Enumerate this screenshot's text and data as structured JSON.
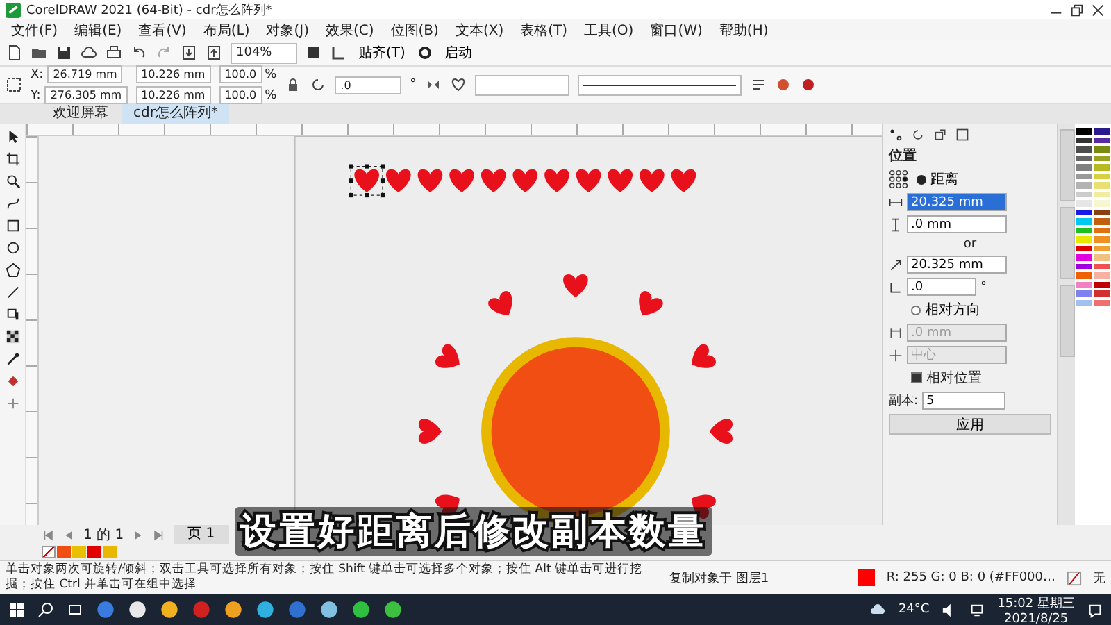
{
  "window": {
    "title": "CorelDRAW 2021 (64-Bit) - cdr怎么阵列*"
  },
  "menu": [
    "文件(F)",
    "编辑(E)",
    "查看(V)",
    "布局(L)",
    "对象(J)",
    "效果(C)",
    "位图(B)",
    "文本(X)",
    "表格(T)",
    "工具(O)",
    "窗口(W)",
    "帮助(H)"
  ],
  "toolbar": {
    "zoom": "104%",
    "snap": "贴齐(T)",
    "launch": "启动"
  },
  "property_bar": {
    "x_label": "X:",
    "x": "26.719 mm",
    "y_label": "Y:",
    "y": "276.305 mm",
    "width": "10.226 mm",
    "height": "10.226 mm",
    "scales": [
      {
        "value": "100.0",
        "unit": "%"
      },
      {
        "value": "100.0",
        "unit": "%"
      }
    ],
    "rotation": ".0",
    "rotation_unit": "°"
  },
  "doc_tabs": [
    {
      "label": "欢迎屏幕",
      "selected": false
    },
    {
      "label": "cdr怎么阵列*",
      "selected": true
    }
  ],
  "heart_row": [
    {
      "selected": true
    },
    {
      "selected": false
    },
    {
      "selected": false
    },
    {
      "selected": false
    },
    {
      "selected": false
    },
    {
      "selected": false
    },
    {
      "selected": false
    },
    {
      "selected": false
    },
    {
      "selected": false
    },
    {
      "selected": false
    },
    {
      "selected": false
    }
  ],
  "caption": "设置好距离后修改副本数量",
  "docker": {
    "title": "位置",
    "modes": [
      {
        "label": "距离",
        "selected": true
      },
      {
        "label": "相对方向",
        "selected": false
      }
    ],
    "distance_fields": [
      {
        "value": "20.325 mm",
        "highlighted": true
      },
      {
        "value": ".0 mm",
        "highlighted": false
      }
    ],
    "or_label": "or",
    "vector_fields": [
      {
        "value": "20.325 mm"
      },
      {
        "value": ".0",
        "unit": "°"
      }
    ],
    "relative_fields": [
      {
        "value": ".0 mm",
        "disabled": true
      },
      {
        "value": "中心",
        "disabled": true
      }
    ],
    "relative_position": {
      "label": "相对位置",
      "checked": true
    },
    "copies_label": "副本:",
    "copies": "5",
    "apply": "应用"
  },
  "palette": [
    {
      "color": "#000000"
    },
    {
      "color": "#2a1a8a"
    },
    {
      "color": "#333333"
    },
    {
      "color": "#5a2aa0"
    },
    {
      "color": "#4d4d4d"
    },
    {
      "color": "#7a8a10"
    },
    {
      "color": "#666666"
    },
    {
      "color": "#9aa020"
    },
    {
      "color": "#808080"
    },
    {
      "color": "#b8b820"
    },
    {
      "color": "#999999"
    },
    {
      "color": "#d8d040"
    },
    {
      "color": "#b3b3b3"
    },
    {
      "color": "#e8e070"
    },
    {
      "color": "#cccccc"
    },
    {
      "color": "#f0eca0"
    },
    {
      "color": "#e6e6e6"
    },
    {
      "color": "#f8f6d0"
    },
    {
      "color": "#1a1ae6"
    },
    {
      "color": "#8a4010"
    },
    {
      "color": "#00c8f0"
    },
    {
      "color": "#c06010"
    },
    {
      "color": "#20c020"
    },
    {
      "color": "#e07010"
    },
    {
      "color": "#e8e800"
    },
    {
      "color": "#f09020"
    },
    {
      "color": "#e00000"
    },
    {
      "color": "#f0a030"
    },
    {
      "color": "#e000e0"
    },
    {
      "color": "#f0c080"
    },
    {
      "color": "#a000e0"
    },
    {
      "color": "#f05050"
    },
    {
      "color": "#f06000"
    },
    {
      "color": "#f8b0a0"
    },
    {
      "color": "#f080c0"
    },
    {
      "color": "#c00000"
    },
    {
      "color": "#8080f0"
    },
    {
      "color": "#d03030"
    },
    {
      "color": "#a0c0f0"
    },
    {
      "color": "#f07070"
    }
  ],
  "page_nav": {
    "count": "1 的 1",
    "page_tab": "页 1"
  },
  "document_palette": [
    {
      "color": "#f04e12"
    },
    {
      "color": "#e8c000"
    },
    {
      "color": "#e00000"
    },
    {
      "color": "#e8b800"
    }
  ],
  "status_bar": {
    "hint": "单击对象两次可旋转/倾斜；双击工具可选择所有对象；按住 Shift 键单击可选择多个对象；按住 Alt 键单击可进行挖掘；按住 Ctrl 并单击可在组中选择",
    "layer": "复制对象于 图层1",
    "fill": "R: 255 G: 0 B: 0 (#FF000…",
    "outline": "无"
  },
  "taskbar": {
    "weather": "24°C",
    "time": "15:02 星期三",
    "date": "2021/8/25"
  }
}
